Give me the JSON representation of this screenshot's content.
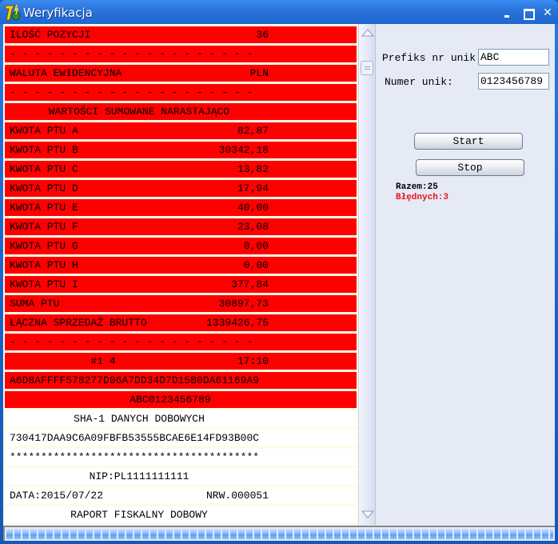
{
  "window": {
    "title": "Weryfikacja",
    "controls": {
      "minimize": "minimize",
      "maximize": "maximize",
      "close": "✕"
    }
  },
  "receipt": {
    "rows": [
      {
        "style": "red",
        "left": "ILOŚĆ POZYCJI",
        "right": "36"
      },
      {
        "style": "red",
        "left": "- - - - - - - - - - - - - - - - - - - -",
        "right": ""
      },
      {
        "style": "red",
        "left": "WALUTA EWIDENCYJNA",
        "right": "PLN"
      },
      {
        "style": "red",
        "left": "- - - - - - - - - - - - - - - - - - - -",
        "right": ""
      },
      {
        "style": "red",
        "center": "WARTOŚCI SUMOWANE NARASTAJĄCO"
      },
      {
        "style": "red",
        "left": "KWOTA PTU A",
        "right": "82,87"
      },
      {
        "style": "red",
        "left": "KWOTA PTU B",
        "right": "30342,18"
      },
      {
        "style": "red",
        "left": "KWOTA PTU C",
        "right": "13,82"
      },
      {
        "style": "red",
        "left": "KWOTA PTU D",
        "right": "17,94"
      },
      {
        "style": "red",
        "left": "KWOTA PTU E",
        "right": "40,00"
      },
      {
        "style": "red",
        "left": "KWOTA PTU F",
        "right": "23,08"
      },
      {
        "style": "red",
        "left": "KWOTA PTU G",
        "right": "0,00"
      },
      {
        "style": "red",
        "left": "KWOTA PTU H",
        "right": "0,00"
      },
      {
        "style": "red",
        "left": "KWOTA PTU I",
        "right": "377,84"
      },
      {
        "style": "red",
        "left": "SUMA PTU",
        "right": "30897,73"
      },
      {
        "style": "red",
        "left": "ŁĄCZNA SPRZEDAŻ BRUTTO",
        "right": "1339426,75"
      },
      {
        "style": "red",
        "left": "- - - - - - - - - - - - - - - - - - - -",
        "right": ""
      },
      {
        "style": "red",
        "left": "             #1 4",
        "right": "17:10"
      },
      {
        "style": "red",
        "left": "A6D8AFFFF578277D06A7DD34D7D15B0DA61169A9",
        "right": ""
      },
      {
        "style": "red",
        "center": "          ABC0123456789"
      },
      {
        "style": "white",
        "center": "SHA-1 DANYCH DOBOWYCH"
      },
      {
        "style": "white",
        "left": "730417DAA9C6A09FBFB53555BCAE6E14FD93B00C",
        "right": ""
      },
      {
        "style": "white",
        "left": "****************************************",
        "right": ""
      },
      {
        "style": "white",
        "center": "NIP:PL1111111111"
      },
      {
        "style": "white",
        "left": "DATA:2015/07/22",
        "right": "NRW.000051"
      },
      {
        "style": "white",
        "center": "RAPORT FISKALNY DOBOWY"
      }
    ]
  },
  "scrollbar": {
    "up": "scroll-up",
    "down": "scroll-down"
  },
  "form": {
    "prefix_label": "Prefiks nr unik",
    "prefix_value": "ABC",
    "number_label": "Numer unik:",
    "number_value": "0123456789"
  },
  "buttons": {
    "start": "Start",
    "stop": "Stop"
  },
  "stats": {
    "total": "Razem:25",
    "errors": "Błędnych:3",
    "error_color": "#e8141e"
  },
  "progress": {
    "percent": 100
  }
}
